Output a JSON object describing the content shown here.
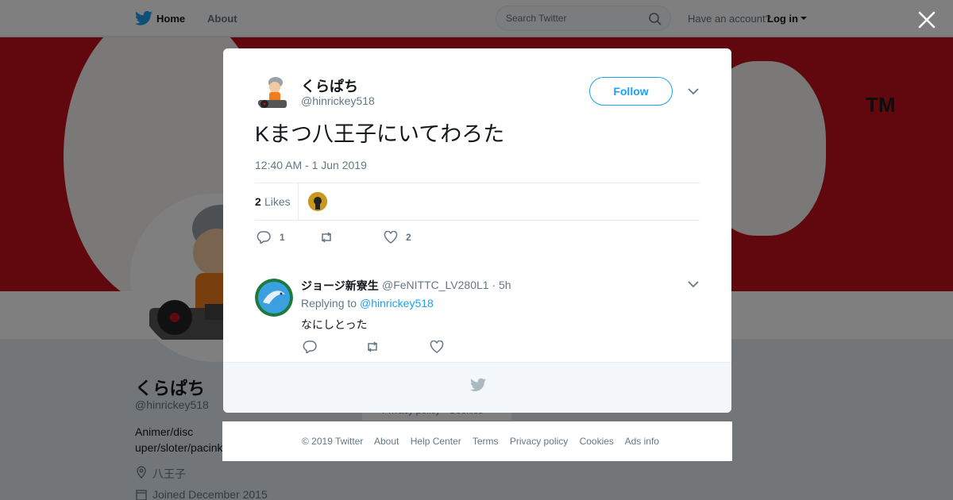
{
  "nav": {
    "home_label": "Home",
    "about_label": "About",
    "search_placeholder": "Search Twitter",
    "have_account": "Have an account?",
    "login_label": "Log in"
  },
  "profile": {
    "name": "くらぱち",
    "handle": "@hinrickey518",
    "bio": "Animer/discuper/sloter/pacink",
    "bio_line1": "Animer/disc",
    "bio_line2": "uper/sloter/pacink",
    "location": "八王子",
    "joined": "Joined December 2015",
    "banner_mark": "TM",
    "bg_footer": "Privacy policy · Cookies"
  },
  "tweet": {
    "author_name": "くらぱち",
    "author_handle": "@hinrickey518",
    "follow_label": "Follow",
    "text": "Kまつ八王子にいてわろた",
    "timestamp": "12:40 AM - 1 Jun 2019",
    "likes_count": "2",
    "likes_label": "Likes",
    "reply_count": "1",
    "retweet_count": "",
    "like_count": "2"
  },
  "reply": {
    "author_name": "ジョージ新寮生",
    "author_handle": "@FeNITTC_LV280L1 · 5h",
    "replying_to_label": "Replying to",
    "replying_to_handle": "@hinrickey518",
    "text": "なにしとった"
  },
  "footer": {
    "links": [
      "© 2019 Twitter",
      "About",
      "Help Center",
      "Terms",
      "Privacy policy",
      "Cookies",
      "Ads info"
    ]
  },
  "colors": {
    "accent": "#1da1f2",
    "banner": "#c3101c",
    "text_secondary": "#657786"
  }
}
